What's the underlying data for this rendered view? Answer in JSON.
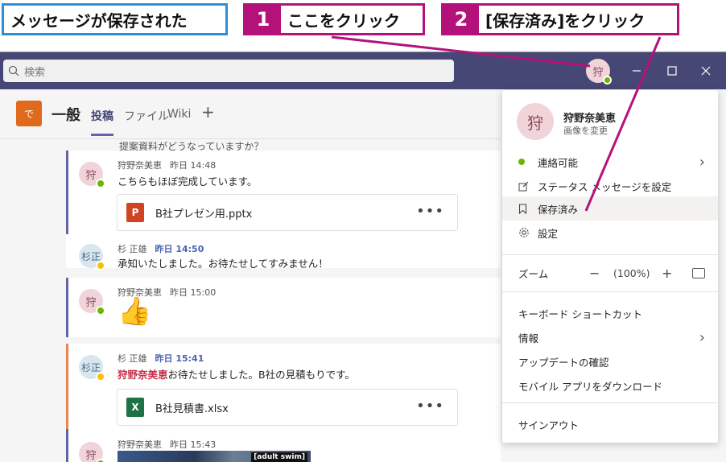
{
  "annotations": {
    "saved_label": "メッセージが保存された",
    "step1": {
      "num": "1",
      "text": "ここをクリック"
    },
    "step2": {
      "num": "2",
      "text": "[保存済み]をクリック"
    }
  },
  "titlebar": {
    "search_placeholder": "検索",
    "avatar_initial": "狩"
  },
  "channel": {
    "team_icon_text": "で",
    "name": "一般",
    "tabs": [
      "投稿",
      "ファイル",
      "Wiki"
    ],
    "add_tab": "+"
  },
  "messages": {
    "prev_text": "提案資料がどうなっていますか？",
    "posts": [
      {
        "initial": "狩",
        "author": "狩野奈美恵",
        "time": "昨日 14:48",
        "body": "こちらもほぼ完成しています。",
        "file": "B社プレゼン用.pptx"
      },
      {
        "initial": "杉正",
        "author": "杉 正雄",
        "time": "昨日 14:50",
        "body": "承知いたしました。お待たせしてすみません！"
      },
      {
        "initial": "狩",
        "author": "狩野奈美恵",
        "time": "昨日 15:00",
        "body": "👍"
      },
      {
        "initial": "杉正",
        "author": "杉 正雄",
        "time": "昨日 15:41",
        "mention": "狩野奈美恵",
        "body": "お待たせしました。B社の見積もりです。",
        "file": "B社見積書.xlsx"
      },
      {
        "initial": "狩",
        "author": "狩野奈美恵",
        "time": "昨日 15:43",
        "video_label": "[adult swim]"
      }
    ],
    "file_more": "•••"
  },
  "menu": {
    "avatar_initial": "狩",
    "name": "狩野奈美恵",
    "change_image": "画像を変更",
    "status": "連絡可能",
    "set_status_message": "ステータス メッセージを設定",
    "saved": "保存済み",
    "settings": "設定",
    "zoom_label": "ズーム",
    "zoom_minus": "−",
    "zoom_value": "(100%)",
    "zoom_plus": "+",
    "shortcuts": "キーボード ショートカット",
    "info": "情報",
    "check_updates": "アップデートの確認",
    "download_mobile": "モバイル アプリをダウンロード",
    "sign_out": "サインアウト"
  },
  "colors": {
    "titlebar": "#464775",
    "callout_blue": "#2b8fd6",
    "callout_magenta": "#b3127a",
    "presence_green": "#6bb700",
    "presence_yellow": "#fbc000"
  }
}
